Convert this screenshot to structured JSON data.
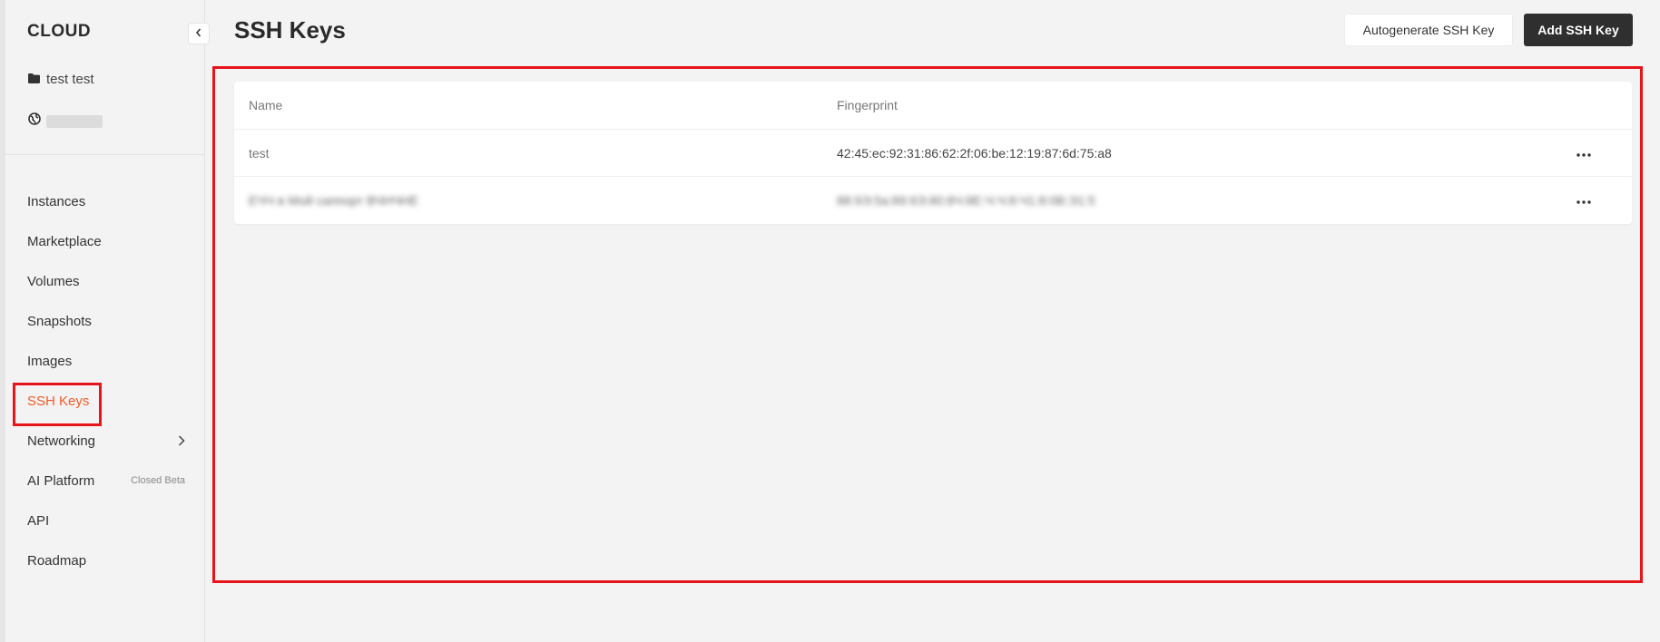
{
  "brand": "CLOUD",
  "project": {
    "name": "test test",
    "icon": "folder-icon"
  },
  "account": {
    "icon": "globe-icon"
  },
  "nav": {
    "items": [
      {
        "label": "Instances"
      },
      {
        "label": "Marketplace"
      },
      {
        "label": "Volumes"
      },
      {
        "label": "Snapshots"
      },
      {
        "label": "Images"
      },
      {
        "label": "SSH Keys",
        "active": true
      },
      {
        "label": "Networking"
      },
      {
        "label": "AI Platform",
        "suffix": "Closed Beta"
      },
      {
        "label": "API"
      },
      {
        "label": "Roadmap"
      }
    ]
  },
  "header": {
    "title": "SSH Keys",
    "autogenerate_label": "Autogenerate SSH Key",
    "add_label": "Add SSH Key"
  },
  "table": {
    "columns": [
      "Name",
      "Fingerprint"
    ],
    "rows": [
      {
        "name": "test",
        "fingerprint": "42:45:ec:92:31:86:62:2f:06:be:12:19:87:6d:75:a8"
      },
      {
        "name": "ЕЧЧ в Мой саппорт ВЧНЧНЕ",
        "fingerprint": "88:9Э:5а:89:9Э:80:8Ч:8Е:Ч:Ч:8:Ч1:8:0В:Э1:5"
      }
    ]
  },
  "colors": {
    "accent": "#f05a28",
    "highlight": "#e8141c",
    "dark_button": "#2f2f2f",
    "background": "#f3f3f3"
  }
}
